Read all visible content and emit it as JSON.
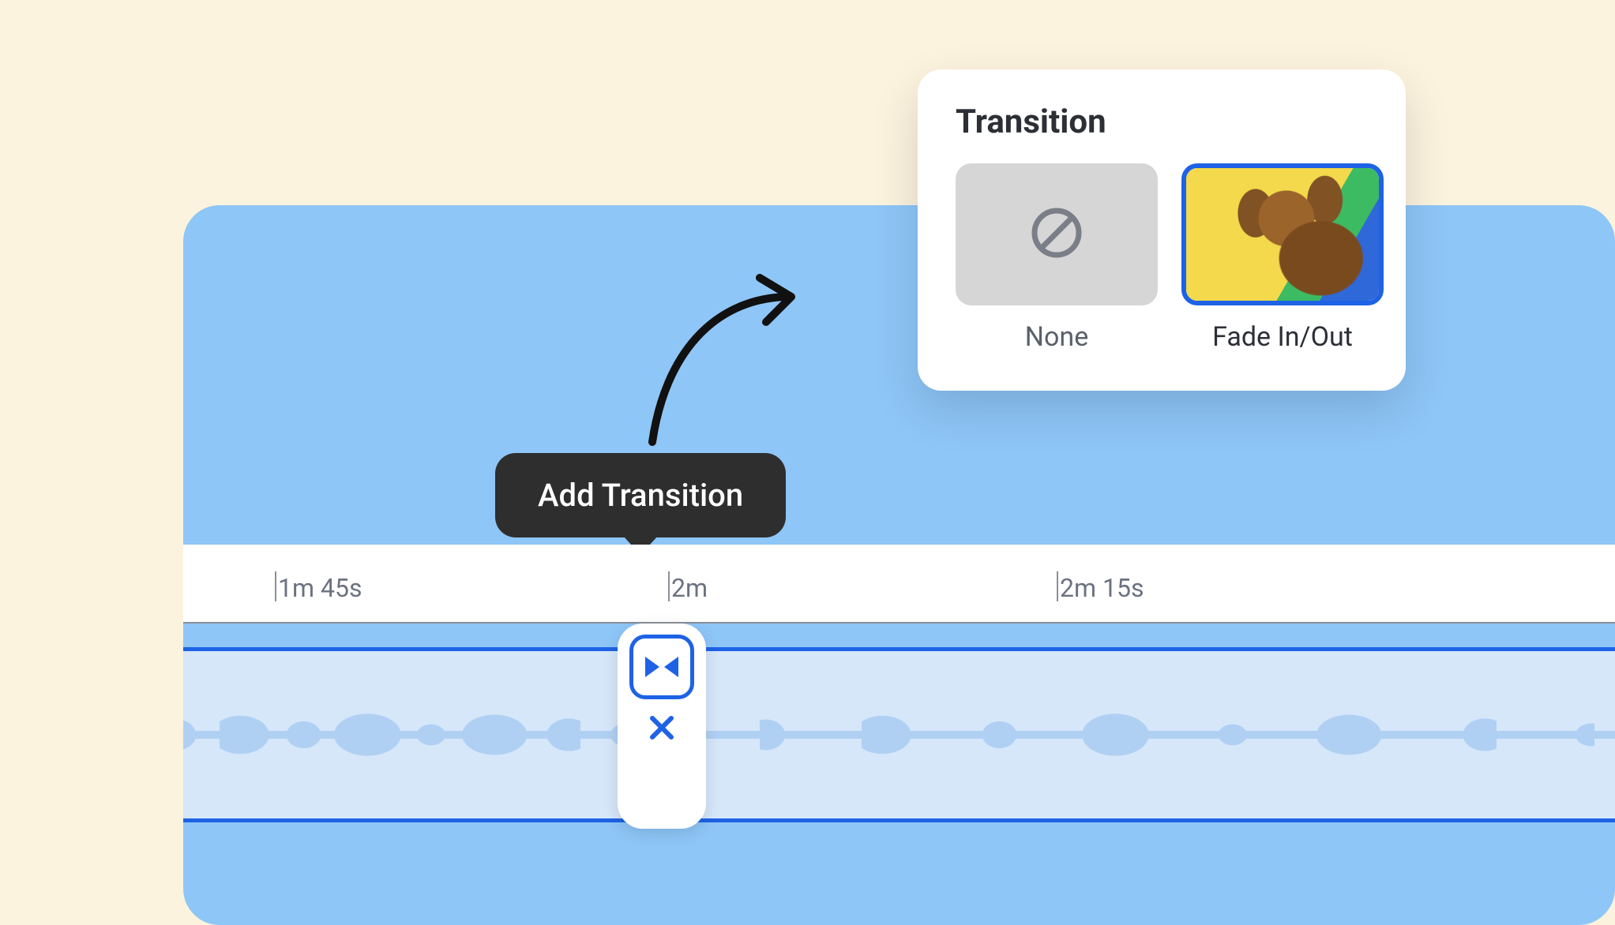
{
  "tooltip": {
    "label": "Add Transition"
  },
  "timeline": {
    "ticks": [
      "1m 45s",
      "2m",
      "2m 15s"
    ]
  },
  "panel": {
    "title": "Transition",
    "options": [
      {
        "label": "None",
        "selected": false
      },
      {
        "label": "Fade In/Out",
        "selected": true
      }
    ]
  }
}
